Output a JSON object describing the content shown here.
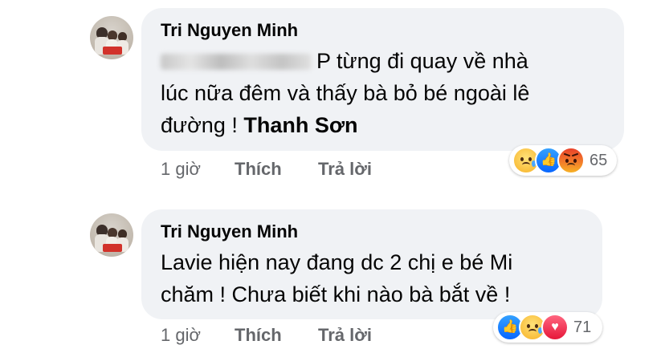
{
  "comments": [
    {
      "author": "Tri Nguyen Minh",
      "text_line1_suffix": "P từng đi quay về nhà",
      "text_line2": "lúc nữa đêm và thấy bà bỏ bé ngoài lê",
      "text_line3": "đường !",
      "tag": "Thanh Sơn",
      "time": "1 giờ",
      "like_label": "Thích",
      "reply_label": "Trả lời",
      "reactions": [
        "sad-icon",
        "like-icon",
        "angry-icon"
      ],
      "reaction_count": "65"
    },
    {
      "author": "Tri Nguyen Minh",
      "text_line1": "Lavie hiện nay đang dc 2 chị e bé Mi",
      "text_line2": "chăm ! Chưa biết khi nào bà bắt về !",
      "time": "1 giờ",
      "like_label": "Thích",
      "reply_label": "Trả lời",
      "reactions": [
        "like-icon",
        "sad-icon",
        "love-icon"
      ],
      "reaction_count": "71"
    }
  ]
}
